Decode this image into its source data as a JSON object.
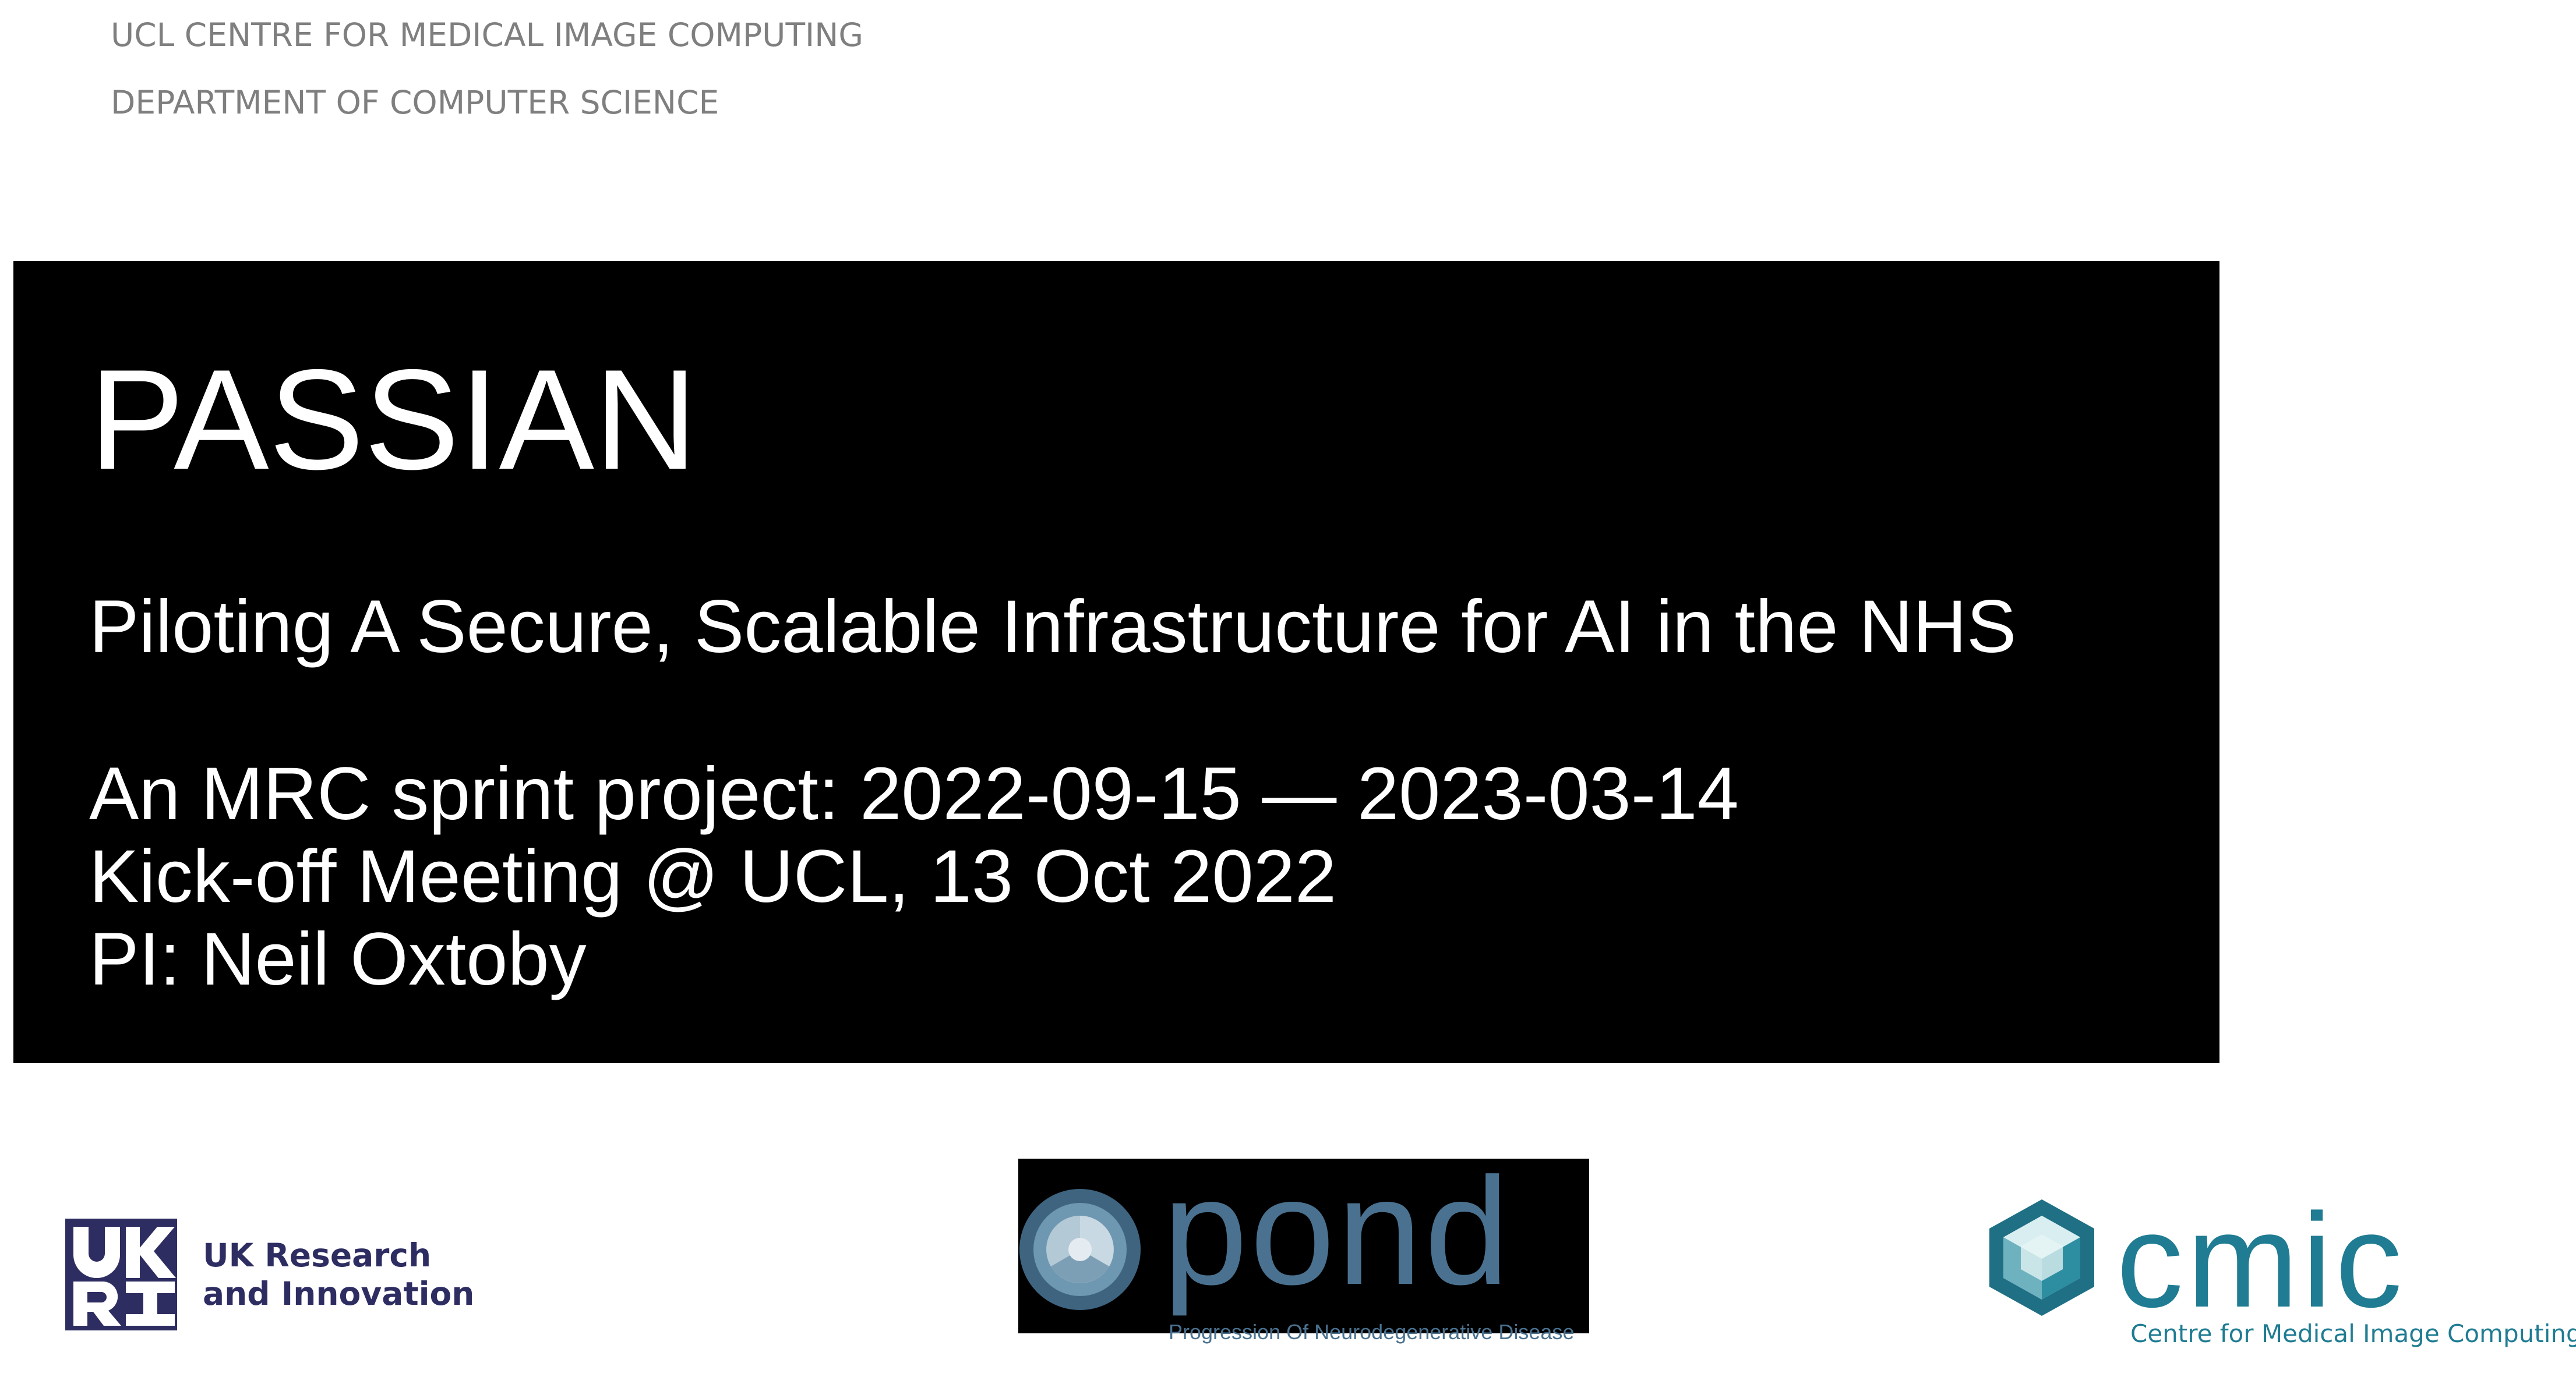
{
  "header": {
    "line1": "UCL CENTRE FOR MEDICAL IMAGE COMPUTING",
    "line2": "DEPARTMENT OF COMPUTER SCIENCE"
  },
  "title_block": {
    "title": "PASSIAN",
    "subtitle": "Piloting A Secure, Scalable Infrastructure for AI in the NHS",
    "info": [
      "An MRC sprint project: 2022-09-15 — 2023-03-14",
      "Kick-off Meeting @ UCL, 13 Oct 2022",
      "PI: Neil Oxtoby"
    ]
  },
  "logos": {
    "ukri": {
      "text_line1": "UK Research",
      "text_line2": "and Innovation",
      "mark_text": "UKRI",
      "color": "#2e2d62"
    },
    "pond": {
      "word": "pond",
      "caption": "Progression Of Neurodegenerative Disease",
      "color": "#4a7290"
    },
    "cmic": {
      "word": "cmic",
      "caption": "Centre for Medical Image Computing",
      "color": "#1f7c92"
    }
  }
}
